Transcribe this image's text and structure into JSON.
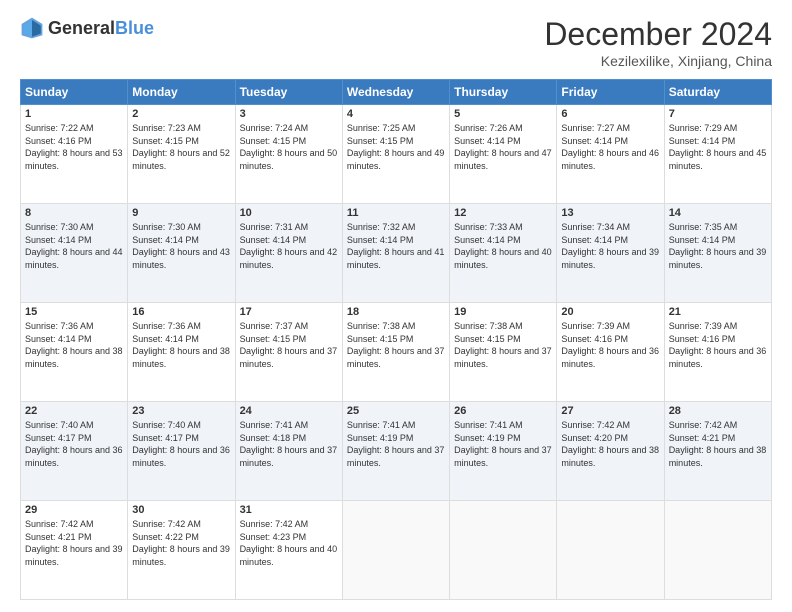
{
  "logo": {
    "general": "General",
    "blue": "Blue"
  },
  "title": "December 2024",
  "location": "Kezilexilike, Xinjiang, China",
  "weekdays": [
    "Sunday",
    "Monday",
    "Tuesday",
    "Wednesday",
    "Thursday",
    "Friday",
    "Saturday"
  ],
  "weeks": [
    [
      {
        "day": "1",
        "sunrise": "7:22 AM",
        "sunset": "4:16 PM",
        "daylight": "8 hours and 53 minutes."
      },
      {
        "day": "2",
        "sunrise": "7:23 AM",
        "sunset": "4:15 PM",
        "daylight": "8 hours and 52 minutes."
      },
      {
        "day": "3",
        "sunrise": "7:24 AM",
        "sunset": "4:15 PM",
        "daylight": "8 hours and 50 minutes."
      },
      {
        "day": "4",
        "sunrise": "7:25 AM",
        "sunset": "4:15 PM",
        "daylight": "8 hours and 49 minutes."
      },
      {
        "day": "5",
        "sunrise": "7:26 AM",
        "sunset": "4:14 PM",
        "daylight": "8 hours and 47 minutes."
      },
      {
        "day": "6",
        "sunrise": "7:27 AM",
        "sunset": "4:14 PM",
        "daylight": "8 hours and 46 minutes."
      },
      {
        "day": "7",
        "sunrise": "7:29 AM",
        "sunset": "4:14 PM",
        "daylight": "8 hours and 45 minutes."
      }
    ],
    [
      {
        "day": "8",
        "sunrise": "7:30 AM",
        "sunset": "4:14 PM",
        "daylight": "8 hours and 44 minutes."
      },
      {
        "day": "9",
        "sunrise": "7:30 AM",
        "sunset": "4:14 PM",
        "daylight": "8 hours and 43 minutes."
      },
      {
        "day": "10",
        "sunrise": "7:31 AM",
        "sunset": "4:14 PM",
        "daylight": "8 hours and 42 minutes."
      },
      {
        "day": "11",
        "sunrise": "7:32 AM",
        "sunset": "4:14 PM",
        "daylight": "8 hours and 41 minutes."
      },
      {
        "day": "12",
        "sunrise": "7:33 AM",
        "sunset": "4:14 PM",
        "daylight": "8 hours and 40 minutes."
      },
      {
        "day": "13",
        "sunrise": "7:34 AM",
        "sunset": "4:14 PM",
        "daylight": "8 hours and 39 minutes."
      },
      {
        "day": "14",
        "sunrise": "7:35 AM",
        "sunset": "4:14 PM",
        "daylight": "8 hours and 39 minutes."
      }
    ],
    [
      {
        "day": "15",
        "sunrise": "7:36 AM",
        "sunset": "4:14 PM",
        "daylight": "8 hours and 38 minutes."
      },
      {
        "day": "16",
        "sunrise": "7:36 AM",
        "sunset": "4:14 PM",
        "daylight": "8 hours and 38 minutes."
      },
      {
        "day": "17",
        "sunrise": "7:37 AM",
        "sunset": "4:15 PM",
        "daylight": "8 hours and 37 minutes."
      },
      {
        "day": "18",
        "sunrise": "7:38 AM",
        "sunset": "4:15 PM",
        "daylight": "8 hours and 37 minutes."
      },
      {
        "day": "19",
        "sunrise": "7:38 AM",
        "sunset": "4:15 PM",
        "daylight": "8 hours and 37 minutes."
      },
      {
        "day": "20",
        "sunrise": "7:39 AM",
        "sunset": "4:16 PM",
        "daylight": "8 hours and 36 minutes."
      },
      {
        "day": "21",
        "sunrise": "7:39 AM",
        "sunset": "4:16 PM",
        "daylight": "8 hours and 36 minutes."
      }
    ],
    [
      {
        "day": "22",
        "sunrise": "7:40 AM",
        "sunset": "4:17 PM",
        "daylight": "8 hours and 36 minutes."
      },
      {
        "day": "23",
        "sunrise": "7:40 AM",
        "sunset": "4:17 PM",
        "daylight": "8 hours and 36 minutes."
      },
      {
        "day": "24",
        "sunrise": "7:41 AM",
        "sunset": "4:18 PM",
        "daylight": "8 hours and 37 minutes."
      },
      {
        "day": "25",
        "sunrise": "7:41 AM",
        "sunset": "4:19 PM",
        "daylight": "8 hours and 37 minutes."
      },
      {
        "day": "26",
        "sunrise": "7:41 AM",
        "sunset": "4:19 PM",
        "daylight": "8 hours and 37 minutes."
      },
      {
        "day": "27",
        "sunrise": "7:42 AM",
        "sunset": "4:20 PM",
        "daylight": "8 hours and 38 minutes."
      },
      {
        "day": "28",
        "sunrise": "7:42 AM",
        "sunset": "4:21 PM",
        "daylight": "8 hours and 38 minutes."
      }
    ],
    [
      {
        "day": "29",
        "sunrise": "7:42 AM",
        "sunset": "4:21 PM",
        "daylight": "8 hours and 39 minutes."
      },
      {
        "day": "30",
        "sunrise": "7:42 AM",
        "sunset": "4:22 PM",
        "daylight": "8 hours and 39 minutes."
      },
      {
        "day": "31",
        "sunrise": "7:42 AM",
        "sunset": "4:23 PM",
        "daylight": "8 hours and 40 minutes."
      },
      null,
      null,
      null,
      null
    ]
  ],
  "labels": {
    "sunrise": "Sunrise:",
    "sunset": "Sunset:",
    "daylight": "Daylight:"
  }
}
